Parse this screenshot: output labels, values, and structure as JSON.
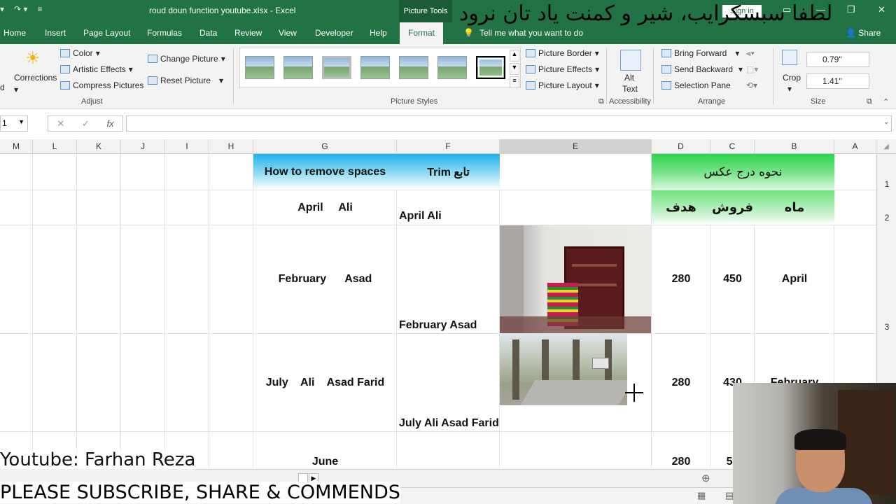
{
  "window": {
    "title": "roud doun function youtube.xlsx  -  Excel",
    "contextual_tab_group": "Picture Tools",
    "sign_in": "Sign in"
  },
  "tabs": [
    "Home",
    "Insert",
    "Page Layout",
    "Formulas",
    "Data",
    "Review",
    "View",
    "Developer",
    "Help",
    "Format"
  ],
  "active_tab": "Format",
  "tell_me": "Tell me what you want to do",
  "share": "Share",
  "ribbon": {
    "adjust": {
      "corrections": "Corrections",
      "color": "Color",
      "artistic_effects": "Artistic Effects",
      "compress_pictures": "Compress Pictures",
      "change_picture": "Change Picture",
      "reset_picture": "Reset Picture",
      "label": "Adjust"
    },
    "picture_styles": {
      "label": "Picture Styles",
      "picture_border": "Picture Border",
      "picture_effects": "Picture Effects",
      "picture_layout": "Picture Layout"
    },
    "accessibility": {
      "alt_text_1": "Alt",
      "alt_text_2": "Text",
      "label": "Accessibility"
    },
    "arrange": {
      "bring_forward": "Bring Forward",
      "send_backward": "Send Backward",
      "selection_pane": "Selection Pane",
      "label": "Arrange"
    },
    "size": {
      "crop": "Crop",
      "height": "0.79\"",
      "width": "1.41\"",
      "label": "Size"
    }
  },
  "formula_bar": {
    "name_box": "1",
    "fx": "fx",
    "cancel": "✕",
    "enter": "✓"
  },
  "columns": [
    "M",
    "L",
    "K",
    "J",
    "I",
    "H",
    "G",
    "F",
    "E",
    "D",
    "C",
    "B",
    "A"
  ],
  "rows": [
    "1",
    "2",
    "3"
  ],
  "cells": {
    "g1": "How to remove spaces",
    "f1": "Trim تابع",
    "dcb1": "نحوه درج عکس",
    "g2": "April     Ali",
    "f2": "April Ali",
    "d2": "هدف",
    "c2": "فروش",
    "b2": "ماه",
    "g3": "February      Asad",
    "f3": "February Asad",
    "d3": "280",
    "c3": "450",
    "b3": "April",
    "g4": "July    Ali    Asad Farid",
    "f4": "July Ali Asad Farid",
    "d4": "280",
    "c4": "430",
    "b4": "February",
    "g5": "June",
    "d5": "280",
    "c5": "57"
  },
  "overlays": {
    "persian_banner": "لطفا سبسکرایب، شیر و کمنت یاد تان نرود",
    "youtube_credit": "Youtube: Farhan Reza",
    "subscribe_text": "PLEASE SUBSCRIBE, SHARE & COMMENDS"
  }
}
